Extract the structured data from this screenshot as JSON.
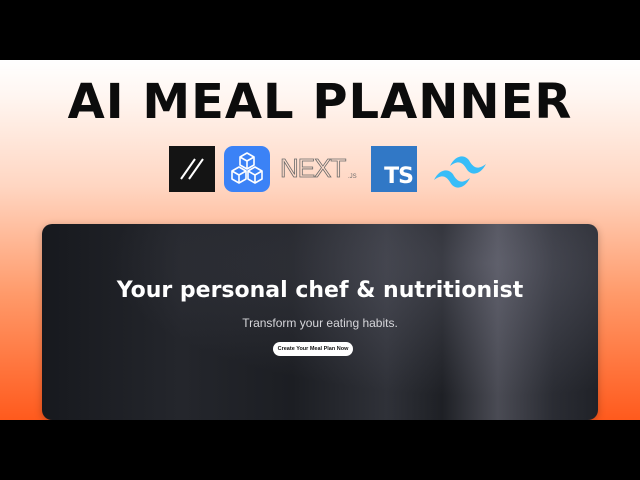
{
  "thumbnail": {
    "headline": "AI MEAL PLANNER",
    "logos": [
      {
        "icon": "slash-logo-icon"
      },
      {
        "icon": "cube-cluster-logo-icon"
      },
      {
        "icon": "nextjs-logo-icon",
        "text": "NEXT",
        "suffix": ".JS"
      },
      {
        "icon": "typescript-logo-icon",
        "text": "TS"
      },
      {
        "icon": "tailwind-logo-icon"
      }
    ],
    "colors": {
      "gradient_top": "#ffffff",
      "gradient_bottom": "#ff5a1d",
      "headline": "#0c0c0c"
    }
  },
  "hero": {
    "title": "Your personal chef & nutritionist",
    "subtitle": "Transform your eating habits.",
    "cta_label": "Create Your Meal Plan Now"
  }
}
